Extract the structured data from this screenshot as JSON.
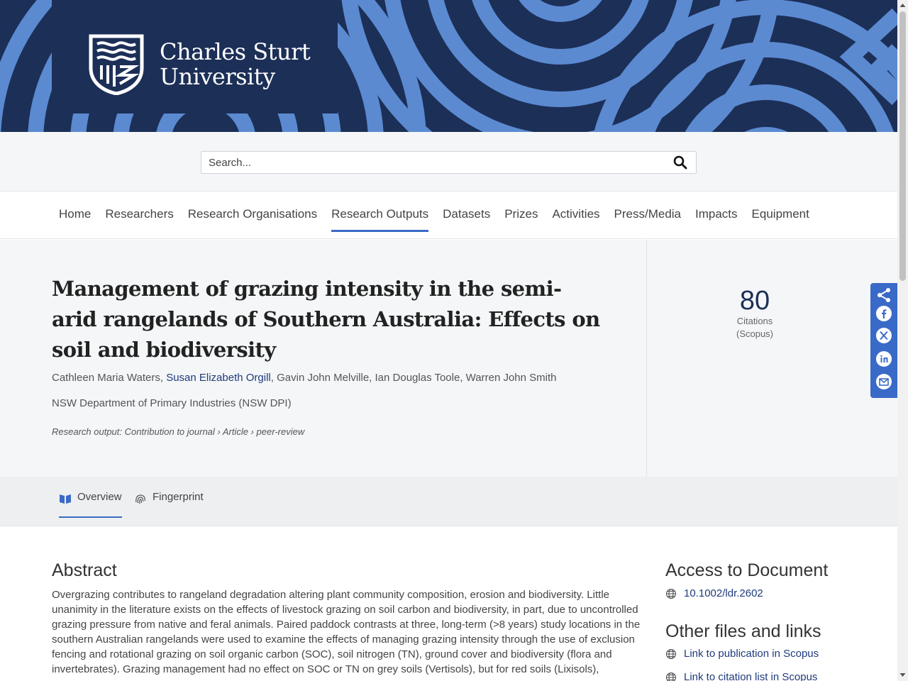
{
  "banner": {
    "logo_line1": "Charles Sturt",
    "logo_line2": "University",
    "colors": {
      "navy": "#1c2f57",
      "pattern_blue": "#5b8ad1"
    }
  },
  "search": {
    "placeholder": "Search..."
  },
  "nav": {
    "items": [
      {
        "label": "Home"
      },
      {
        "label": "Researchers"
      },
      {
        "label": "Research Organisations"
      },
      {
        "label": "Research Outputs",
        "active": true
      },
      {
        "label": "Datasets"
      },
      {
        "label": "Prizes"
      },
      {
        "label": "Activities"
      },
      {
        "label": "Press/Media"
      },
      {
        "label": "Impacts"
      },
      {
        "label": "Equipment"
      }
    ]
  },
  "publication": {
    "title": "Management of grazing intensity in the semi-arid rangelands of Southern Australia: Effects on soil and biodiversity",
    "authors": {
      "a1": "Cathleen Maria Waters",
      "a2": "Susan Elizabeth Orgill",
      "a3": "Gavin John Melville",
      "a4": "Ian Douglas Toole",
      "a5": "Warren John Smith"
    },
    "organisation": "NSW Department of Primary Industries (NSW DPI)",
    "output_type": "Research output: Contribution to journal › Article › peer-review"
  },
  "metrics": {
    "citations": "80",
    "label1": "Citations",
    "label2": "(Scopus)"
  },
  "share": {
    "icons": [
      "share-icon",
      "facebook-icon",
      "x-icon",
      "linkedin-icon",
      "email-icon"
    ]
  },
  "tabs": [
    {
      "label": "Overview",
      "active": true
    },
    {
      "label": "Fingerprint"
    }
  ],
  "abstract": {
    "heading": "Abstract",
    "text": "Overgrazing contributes to rangeland degradation altering plant community composition, erosion and biodiversity. Little unanimity in the literature exists on the effects of livestock grazing on soil carbon and biodiversity, in part, due to uncontrolled grazing pressure from native and feral animals. Paired paddock contrasts at three, long-term (>8 years) study locations in the southern Australian rangelands were used to examine the effects of managing grazing intensity through the use of exclusion fencing and rotational grazing on soil organic carbon (SOC), soil nitrogen (TN), ground cover and biodiversity (flora and invertebrates). Grazing management had no effect on SOC or TN on grey soils (Vertisols), but for red soils (Lixisols),"
  },
  "sidebar": {
    "access_heading": "Access to Document",
    "doi": "10.1002/ldr.2602",
    "other_heading": "Other files and links",
    "link1": "Link to publication in Scopus",
    "link2": "Link to citation list in Scopus"
  }
}
